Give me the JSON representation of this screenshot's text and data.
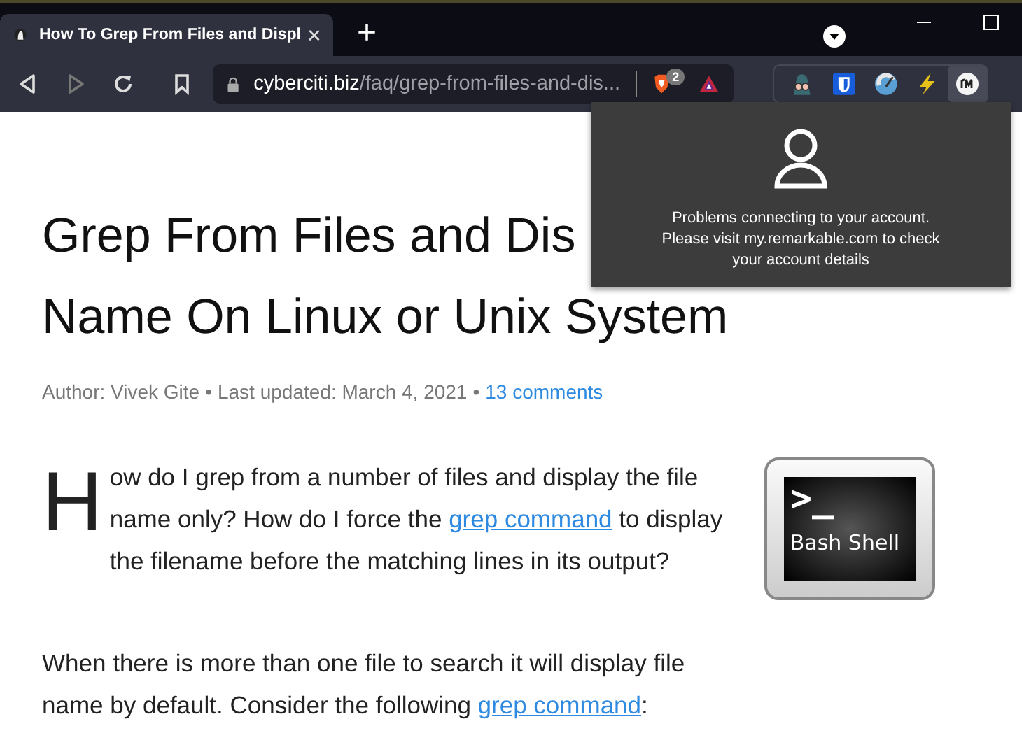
{
  "tab": {
    "title": "How To Grep From Files and Displ",
    "selected": true
  },
  "tab_close": "✕",
  "new_tab": "+",
  "toolbar": {
    "forward_disabled": true,
    "url_host": "cyberciti.biz",
    "url_path": "/faq/grep-from-files-and-dis...",
    "shields_badge": "2"
  },
  "popup": {
    "message": "Problems connecting to your account. Please visit my.remarkable.com to check your account details"
  },
  "article": {
    "title_lines": [
      "Grep From Files and Dis",
      "Name On Linux or Unix System"
    ],
    "meta": {
      "author": "Author: Vivek Gite",
      "sep_1": "•",
      "updated": "Last updated: March 4, 2021",
      "sep_2": "•",
      "comments": "13 comments"
    },
    "drop_cap": "H",
    "paragraphs": [
      [
        {
          "text": "ow do I grep from a number of files and display the file name only? How do I force the "
        },
        {
          "text": "grep command",
          "link": true
        },
        {
          "text": " to display the filename before the matching lines in its output?"
        }
      ],
      [
        {
          "text": "When there is more than one file to search it will display file name by default. Consider the following "
        },
        {
          "text": "grep command",
          "link": true
        },
        {
          "text": ":"
        }
      ]
    ],
    "logo": {
      "prompt": ">_",
      "caption": "Bash Shell"
    }
  }
}
